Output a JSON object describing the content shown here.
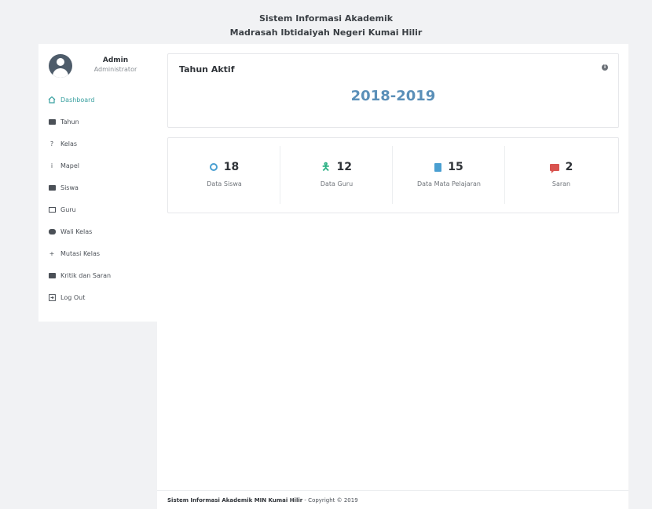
{
  "header": {
    "line1": "Sistem Informasi Akademik",
    "line2": "Madrasah Ibtidaiyah Negeri Kumai Hilir"
  },
  "user": {
    "name": "Admin",
    "role": "Administrator"
  },
  "sidebar": {
    "items": [
      {
        "label": "Dashboard",
        "icon": "home-icon"
      },
      {
        "label": "Tahun",
        "icon": "calendar-icon"
      },
      {
        "label": "Kelas",
        "icon": "question-icon"
      },
      {
        "label": "Mapel",
        "icon": "info-icon"
      },
      {
        "label": "Siswa",
        "icon": "id-card-icon"
      },
      {
        "label": "Guru",
        "icon": "chat-icon"
      },
      {
        "label": "Wali Kelas",
        "icon": "gamepad-icon"
      },
      {
        "label": "Mutasi Kelas",
        "icon": "plus-icon"
      },
      {
        "label": "Kritik dan Saran",
        "icon": "comment-icon"
      },
      {
        "label": "Log Out",
        "icon": "logout-icon"
      }
    ],
    "active_index": 0
  },
  "tahun_card": {
    "title": "Tahun Aktif",
    "year": "2018-2019"
  },
  "stats": [
    {
      "value": "18",
      "label": "Data Siswa",
      "icon": "smile-icon",
      "color": "#4a9fd1"
    },
    {
      "value": "12",
      "label": "Data Guru",
      "icon": "person-icon",
      "color": "#2bb184"
    },
    {
      "value": "15",
      "label": "Data Mata Pelajaran",
      "icon": "book-icon",
      "color": "#4a9fd1"
    },
    {
      "value": "2",
      "label": "Saran",
      "icon": "comment-icon",
      "color": "#d9534f"
    }
  ],
  "footer": {
    "bold": "Sistem Informasi Akademik MIN Kumai Hilir",
    "rest": " - Copyright © 2019"
  },
  "colors": {
    "accent": "#39a0a0",
    "year": "#5a8fb8"
  }
}
